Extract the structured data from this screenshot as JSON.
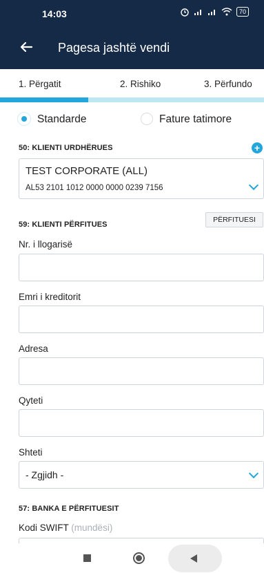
{
  "status": {
    "time": "14:03",
    "icons": [
      "alarm-icon",
      "signal-icon",
      "signal-icon",
      "wifi-icon"
    ],
    "battery": "70"
  },
  "appbar": {
    "title": "Pagesa jashtë vendi"
  },
  "steps": [
    {
      "label": "1. Përgatit",
      "active": true
    },
    {
      "label": "2. Rishiko",
      "active": false
    },
    {
      "label": "3. Përfundo",
      "active": false
    }
  ],
  "progress": {
    "step": 1,
    "total": 3
  },
  "payment_type": {
    "options": [
      {
        "label": "Standarde",
        "selected": true
      },
      {
        "label": "Fature tatimore",
        "selected": false
      }
    ]
  },
  "ordering": {
    "title": "50: KLIENTI URDHËRUES",
    "account_name": "TEST CORPORATE (ALL)",
    "iban": "AL53 2101 1012 0000 0000 0239 7156"
  },
  "beneficiary": {
    "title": "59: KLIENTI PËRFITUES",
    "button_label": "PËRFITUESI",
    "fields": {
      "account_label": "Nr. i llogarisë",
      "creditor_label": "Emri i kreditorit",
      "address_label": "Adresa",
      "city_label": "Qyteti",
      "country_label": "Shteti",
      "country_value": "- Zgjidh -"
    }
  },
  "bank": {
    "title": "57: BANKA E PËRFITUESIT",
    "swift_label": "Kodi SWIFT",
    "swift_optional": "(mundësi)"
  },
  "colors": {
    "header": "#152a47",
    "accent": "#23a6dc",
    "progress_track": "#bfe6f5"
  }
}
